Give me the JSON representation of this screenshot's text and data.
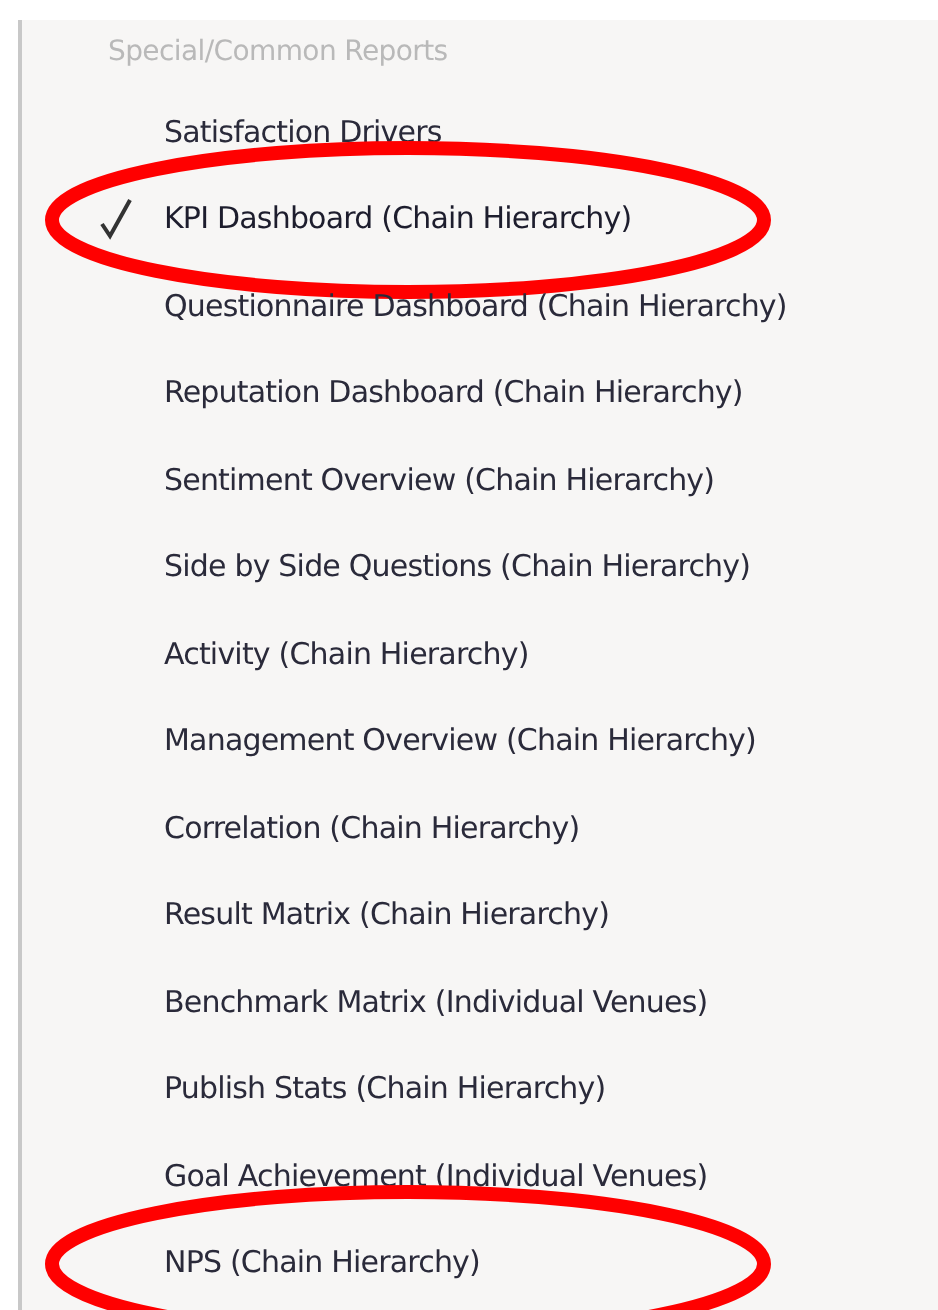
{
  "menu": {
    "heading": "Special/Common Reports",
    "items": [
      {
        "label": "Satisfaction Drivers",
        "selected": false,
        "circled": false
      },
      {
        "label": "KPI Dashboard (Chain Hierarchy)",
        "selected": true,
        "circled": true
      },
      {
        "label": "Questionnaire Dashboard (Chain Hierarchy)",
        "selected": false,
        "circled": false
      },
      {
        "label": "Reputation Dashboard (Chain Hierarchy)",
        "selected": false,
        "circled": false
      },
      {
        "label": "Sentiment Overview (Chain Hierarchy)",
        "selected": false,
        "circled": false
      },
      {
        "label": "Side by Side Questions (Chain Hierarchy)",
        "selected": false,
        "circled": false
      },
      {
        "label": "Activity (Chain Hierarchy)",
        "selected": false,
        "circled": false
      },
      {
        "label": "Management Overview (Chain Hierarchy)",
        "selected": false,
        "circled": false
      },
      {
        "label": "Correlation (Chain Hierarchy)",
        "selected": false,
        "circled": false
      },
      {
        "label": "Result Matrix (Chain Hierarchy)",
        "selected": false,
        "circled": false
      },
      {
        "label": "Benchmark Matrix (Individual Venues)",
        "selected": false,
        "circled": false
      },
      {
        "label": "Publish Stats (Chain Hierarchy)",
        "selected": false,
        "circled": false
      },
      {
        "label": "Goal Achievement (Individual Venues)",
        "selected": false,
        "circled": false
      },
      {
        "label": "NPS (Chain Hierarchy)",
        "selected": false,
        "circled": true
      }
    ]
  }
}
